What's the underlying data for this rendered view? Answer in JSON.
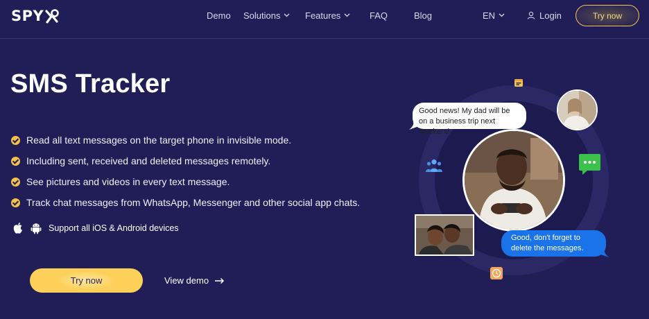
{
  "header": {
    "logo": "SPY",
    "nav": [
      {
        "label": "Demo"
      },
      {
        "label": "Solutions"
      },
      {
        "label": "Features"
      },
      {
        "label": "FAQ"
      },
      {
        "label": "Blog"
      }
    ],
    "language": "EN",
    "login": "Login",
    "try_now": "Try now"
  },
  "hero": {
    "title": "SMS Tracker",
    "features": [
      "Read all text messages on the target phone in invisible mode.",
      "Including sent, received and deleted messages remotely.",
      "See pictures and videos in every text message.",
      "Track chat messages from WhatsApp, Messenger and other social app chats."
    ],
    "support": "Support all iOS & Android devices",
    "try_now": "Try now",
    "view_demo": "View demo"
  },
  "illustration": {
    "bubble_incoming": "Good news! My dad will be on a business trip next weekend",
    "bubble_outgoing": "Good, don't forget to delete the messages."
  },
  "colors": {
    "background": "#211d57",
    "accent": "#fdd05a",
    "bubble_blue": "#1a73e8"
  }
}
